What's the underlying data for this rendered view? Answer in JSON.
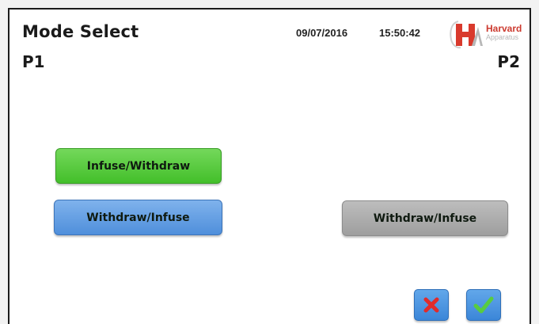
{
  "header": {
    "title": "Mode Select",
    "date": "09/07/2016",
    "time": "15:50:42",
    "logo": {
      "text": "Harvard",
      "subtext": "Apparatus"
    }
  },
  "pumps": {
    "p1_label": "P1",
    "p2_label": "P2"
  },
  "p1_modes": [
    {
      "label": "Infuse/Withdraw",
      "state": "selected",
      "color": "#4cc535"
    },
    {
      "label": "Withdraw/Infuse",
      "state": "unselected",
      "color": "#5b97de"
    }
  ],
  "p2_modes": [
    {
      "label": "Withdraw/Infuse",
      "state": "disabled",
      "color": "#a8a8a8"
    }
  ],
  "actions": {
    "cancel_icon": "close-icon",
    "confirm_icon": "check-icon",
    "cancel_color": "#e53030",
    "confirm_color": "#4fc63b"
  }
}
